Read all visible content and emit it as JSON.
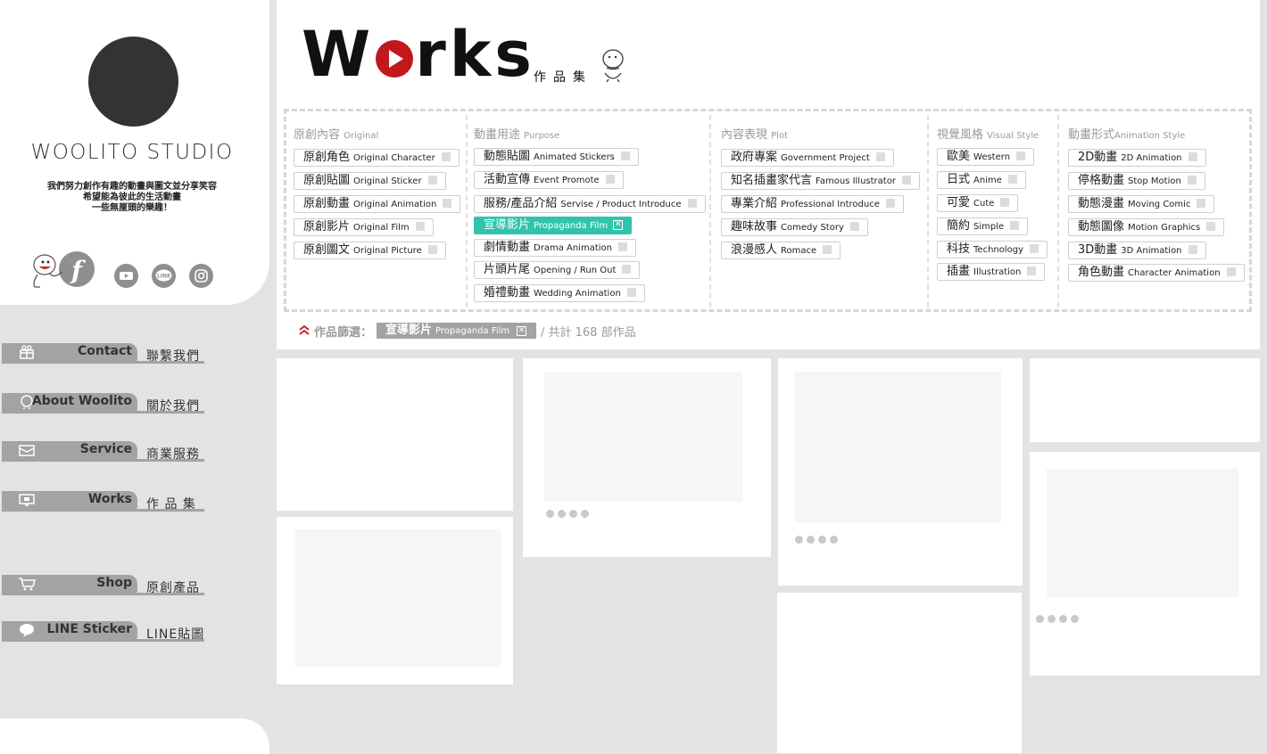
{
  "sidebar": {
    "studio_name": "WOOLITO STUDIO",
    "tagline": [
      "我們努力創作有趣的動畫與圖文並分享笑容",
      "希望能為彼此的生活動畫",
      "一些無厘頭的樂趣！"
    ],
    "social": {
      "facebook": "f",
      "youtube": "You Tube",
      "line": "LINE",
      "instagram": "instagram-icon"
    },
    "nav": [
      {
        "label": "Contact",
        "zh": "聯繫我們",
        "icon": "gift-icon"
      },
      {
        "label": "About Woolito",
        "zh": "關於我們",
        "icon": "mascot-icon"
      },
      {
        "label": "Service",
        "zh": "商業服務",
        "icon": "mail-icon"
      },
      {
        "label": "Works",
        "zh": "作 品 集",
        "icon": "monitor-icon"
      },
      {
        "label": "Shop",
        "zh": "原創產品",
        "icon": "cart-icon"
      },
      {
        "label": "LINE Sticker",
        "zh": "LINE貼圖",
        "icon": "chat-bubble-icon"
      }
    ]
  },
  "header": {
    "title_w": "W",
    "title_rest": "rks",
    "subtitle": "作品集"
  },
  "filters": {
    "original": {
      "title": "原創內容",
      "title_en": "Original",
      "tags": [
        {
          "zh": "原創角色",
          "en": "Original Character"
        },
        {
          "zh": "原創貼圖",
          "en": "Original Sticker"
        },
        {
          "zh": "原創動畫",
          "en": "Original Animation"
        },
        {
          "zh": "原創影片",
          "en": "Original Film"
        },
        {
          "zh": "原創圖文",
          "en": "Original Picture"
        }
      ]
    },
    "purpose": {
      "title": "動畫用途",
      "title_en": "Purpose",
      "tags": [
        {
          "zh": "動態貼圖",
          "en": "Animated Stickers"
        },
        {
          "zh": "活動宣傳",
          "en": "Event Promote"
        },
        {
          "zh": "服務/產品介紹",
          "en": "Servise / Product Introduce"
        },
        {
          "zh": "宣導影片",
          "en": "Propaganda Film",
          "active": true
        },
        {
          "zh": "劇情動畫",
          "en": "Drama Animation"
        },
        {
          "zh": "片頭片尾",
          "en": "Opening / Run Out"
        },
        {
          "zh": "婚禮動畫",
          "en": "Wedding Animation"
        }
      ]
    },
    "plot": {
      "title": "內容表現",
      "title_en": "Plot",
      "tags": [
        {
          "zh": "政府專案",
          "en": "Government Project"
        },
        {
          "zh": "知名插畫家代言",
          "en": "Famous Illustrator"
        },
        {
          "zh": "專業介紹",
          "en": "Professional Introduce"
        },
        {
          "zh": "趣味故事",
          "en": "Comedy Story"
        },
        {
          "zh": "浪漫感人",
          "en": "Romace"
        }
      ]
    },
    "visual": {
      "title": "視覺風格",
      "title_en": "Visual Style",
      "tags": [
        {
          "zh": "歐美",
          "en": "Western"
        },
        {
          "zh": "日式",
          "en": "Anime"
        },
        {
          "zh": "可愛",
          "en": "Cute"
        },
        {
          "zh": "簡約",
          "en": "Simple"
        },
        {
          "zh": "科技",
          "en": "Technology"
        },
        {
          "zh": "插畫",
          "en": "Illustration"
        }
      ]
    },
    "animation": {
      "title": "動畫形式",
      "title_en": "Animation Style",
      "tags": [
        {
          "zh": "2D動畫",
          "en": "2D Animation"
        },
        {
          "zh": "停格動畫",
          "en": "Stop Motion"
        },
        {
          "zh": "動態漫畫",
          "en": "Moving Comic"
        },
        {
          "zh": "動態圖像",
          "en": "Motion Graphics"
        },
        {
          "zh": "3D動畫",
          "en": "3D Animation"
        },
        {
          "zh": "角色動畫",
          "en": "Character Animation"
        }
      ]
    }
  },
  "filter_status": {
    "label": "作品篩選：",
    "chip_zh": "宣導影片",
    "chip_en": "Propaganda Film",
    "chip_close": "✕",
    "count_text": "/ 共計 168 部作品"
  },
  "colors": {
    "accent_teal": "#2fc5ad",
    "brand_red": "#c2171d",
    "nav_gray": "#a3a3a3"
  }
}
